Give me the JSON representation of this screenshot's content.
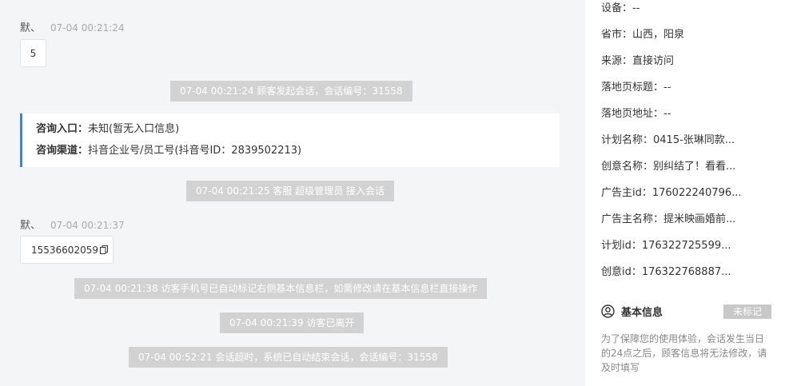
{
  "chat": {
    "messages": [
      {
        "sender": "默、",
        "time": "07-04 00:21:24",
        "text": "5"
      },
      {
        "sender": "默、",
        "time": "07-04 00:21:37",
        "text": "15536602059"
      }
    ],
    "system": [
      "07-04 00:21:24 顾客发起会话，会话编号：31558",
      "07-04 00:21:25 客服 超级管理员 接入会话",
      "07-04 00:21:38 访客手机号已自动标记右侧基本信息栏，如需修改请在基本信息栏直接操作",
      "07-04 00:21:39 访客已离开",
      "07-04 00:52:21 会话超时，系统已自动结束会话，会话编号：31558"
    ],
    "entry": {
      "entry_label": "咨询入口：",
      "entry_value": "未知(暂无入口信息)",
      "channel_label": "咨询渠道：",
      "channel_value": "抖音企业号/员工号(抖音号ID：2839502213)"
    }
  },
  "sidebar": {
    "rows": [
      "设备：--",
      "省市：山西，阳泉",
      "来源：直接访问",
      "落地页标题：--",
      "落地页地址：--",
      "计划名称：0415-张琳同款...",
      "创意名称：别纠结了！看看...",
      "广告主id：176022240796...",
      "广告主名称：提米映画婚前...",
      "计划id：176322725599...",
      "创意id：176322768887..."
    ],
    "basic_info_title": "基本信息",
    "tag": "未标记",
    "notice": "为了保障您的使用体验，会话发生当日的24点之后，顾客信息将无法修改，请及时填写"
  },
  "colors": {
    "accent": "#3c7ff5",
    "system_bubble": "#d2d2d2",
    "chat_bg": "#f4f5f7"
  }
}
